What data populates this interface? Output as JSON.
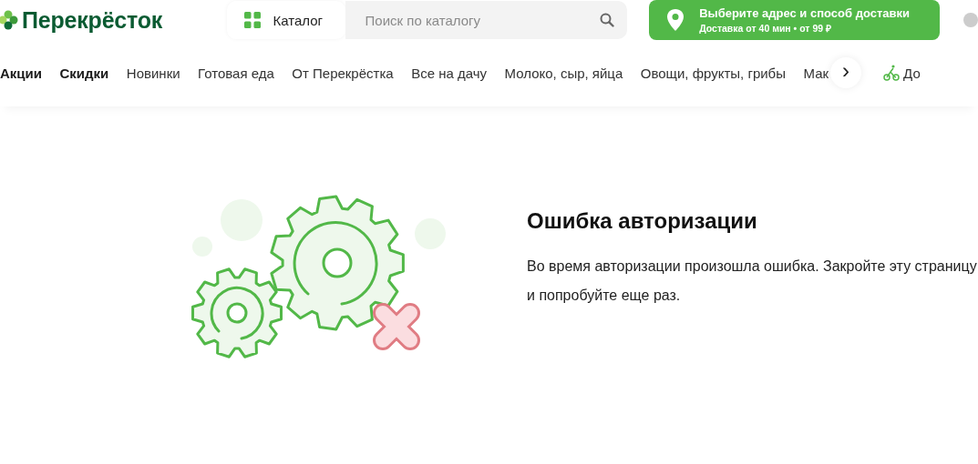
{
  "header": {
    "logo": "Перекрёсток",
    "catalog_button": "Каталог",
    "search": {
      "placeholder": "Поиск по каталогу"
    },
    "delivery": {
      "title": "Выберите адрес и способ доставки",
      "subtitle": "Доставка от 40 мин • от 99 ₽"
    }
  },
  "nav": {
    "items": [
      {
        "label": "Акции",
        "bold": true
      },
      {
        "label": "Скидки",
        "bold": true
      },
      {
        "label": "Новинки",
        "bold": false
      },
      {
        "label": "Готовая еда",
        "bold": false
      },
      {
        "label": "От Перекрёстка",
        "bold": false
      },
      {
        "label": "Все на дачу",
        "bold": false
      },
      {
        "label": "Молоко, сыр, яйца",
        "bold": false
      },
      {
        "label": "Овощи, фрукты, грибы",
        "bold": false
      },
      {
        "label": "Мак",
        "bold": false
      }
    ],
    "next_button": "›",
    "extra_link": "До"
  },
  "error": {
    "title": "Ошибка авторизации",
    "message": "Во время авторизации произошла ошибка. Закройте эту страницу и попробуйте еще раз."
  }
}
